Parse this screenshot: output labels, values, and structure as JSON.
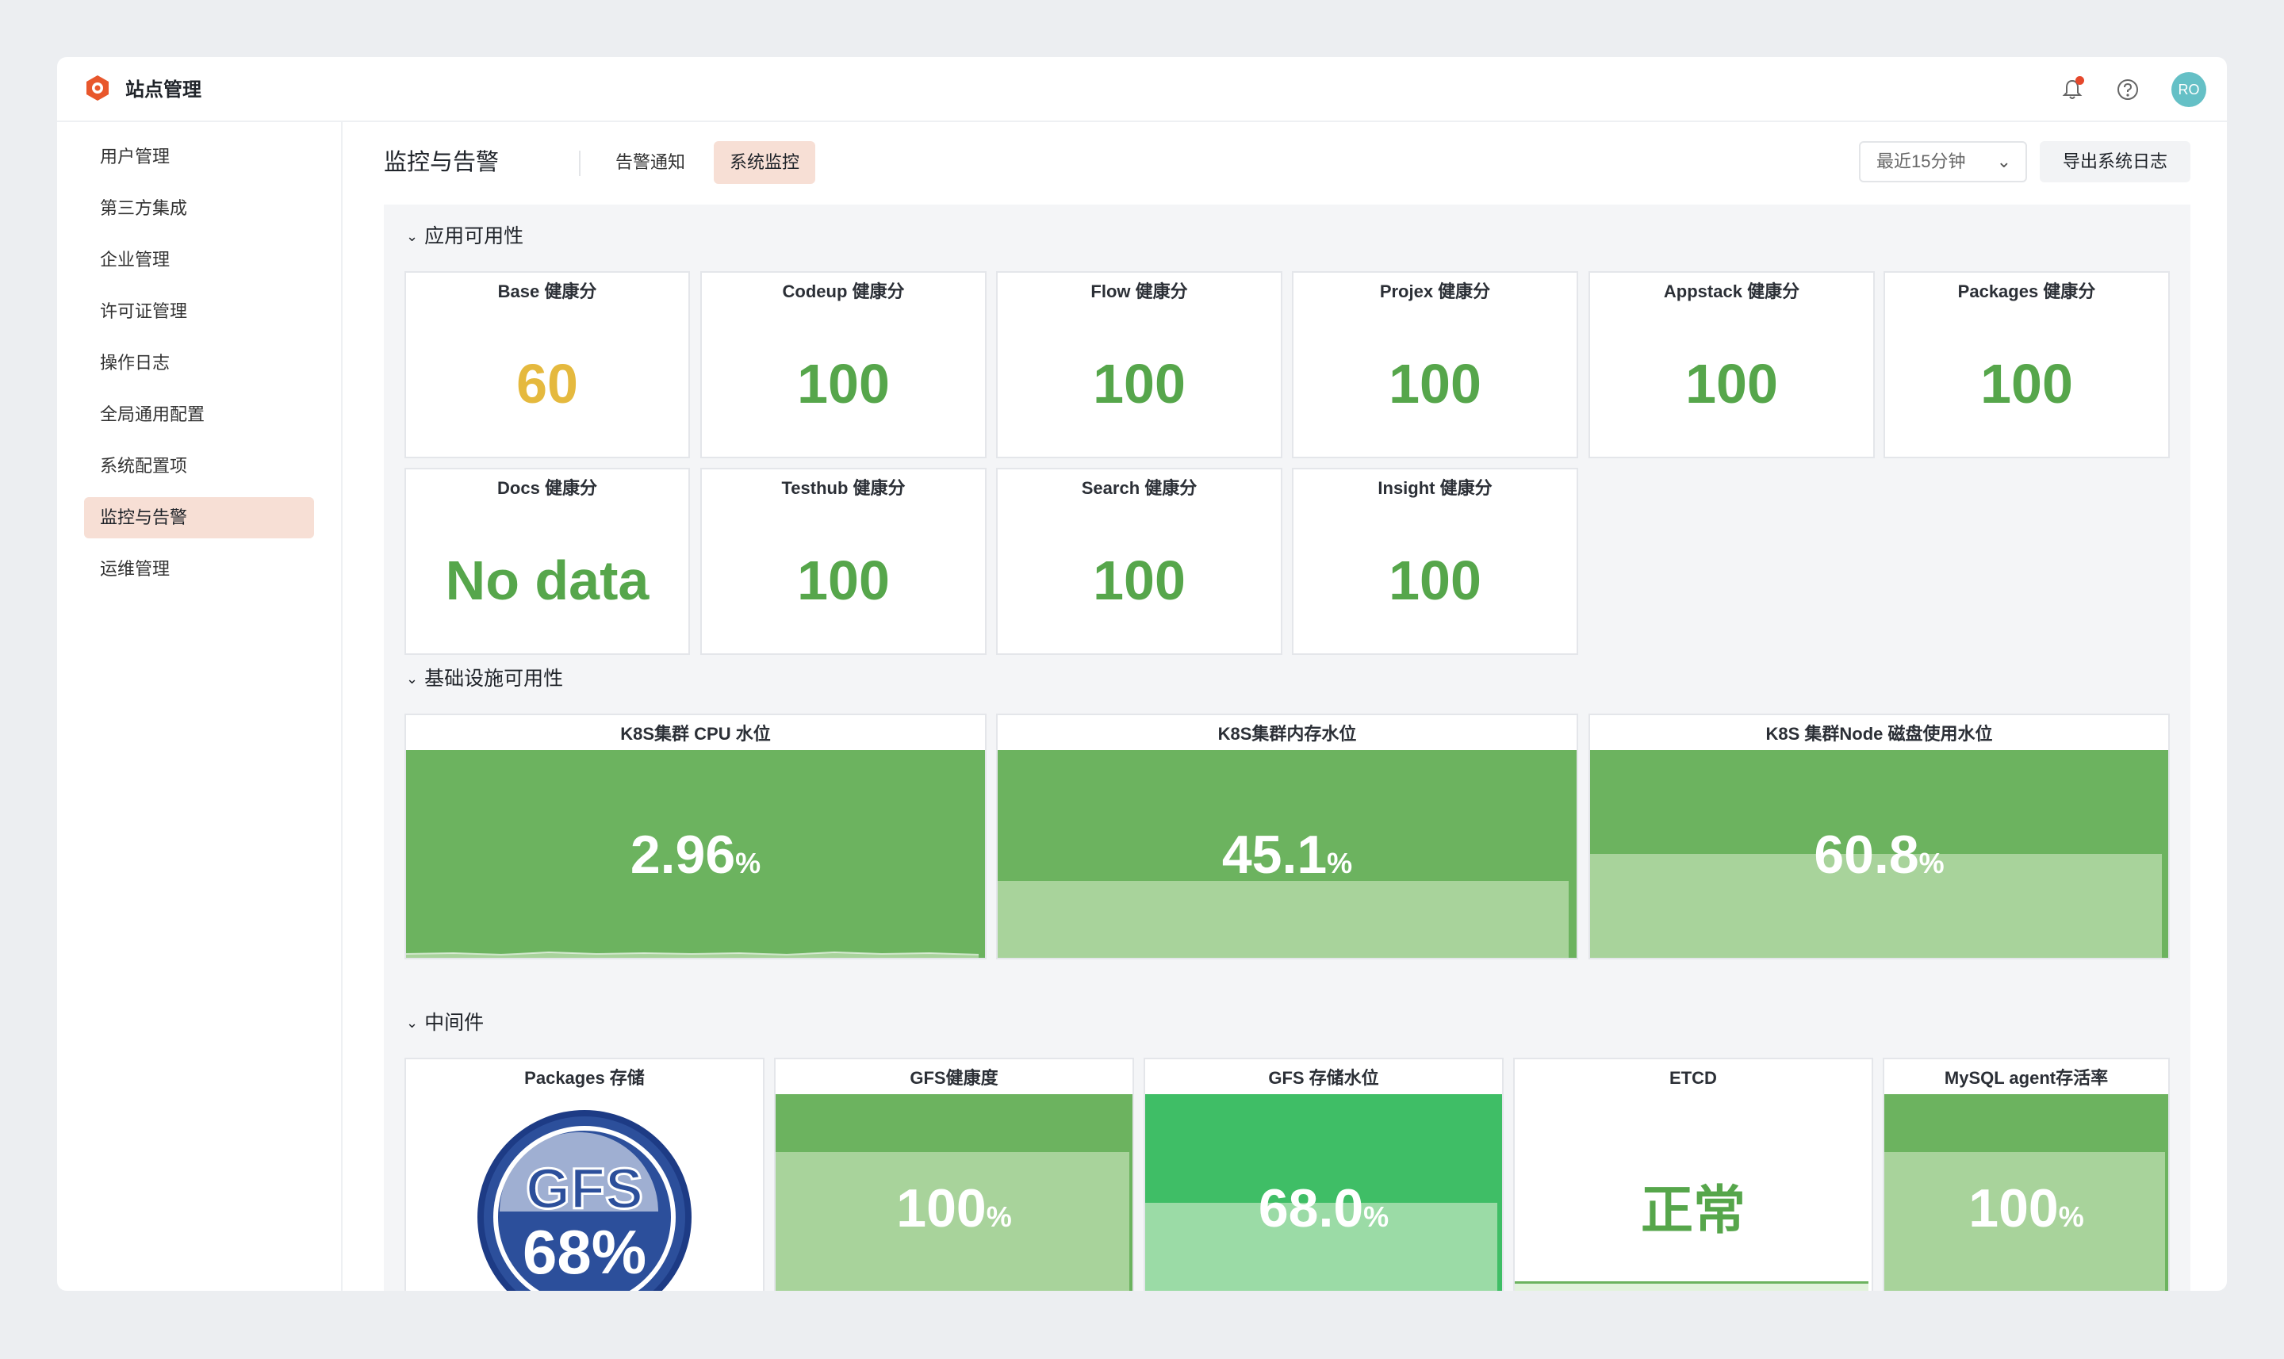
{
  "header": {
    "title": "站点管理",
    "avatar": "RO",
    "icons": [
      "logo-icon",
      "bell-icon",
      "help-icon"
    ],
    "notification_dot_color": "#e5482c"
  },
  "sidebar": {
    "items": [
      {
        "label": "用户管理"
      },
      {
        "label": "第三方集成"
      },
      {
        "label": "企业管理"
      },
      {
        "label": "许可证管理"
      },
      {
        "label": "操作日志"
      },
      {
        "label": "全局通用配置"
      },
      {
        "label": "系统配置项"
      },
      {
        "label": "监控与告警",
        "active": true
      },
      {
        "label": "运维管理"
      }
    ]
  },
  "main": {
    "title": "监控与告警",
    "tabs": [
      {
        "label": "告警通知"
      },
      {
        "label": "系统监控",
        "active": true
      }
    ],
    "time_range": "最近15分钟",
    "export_label": "导出系统日志"
  },
  "sections": {
    "app_availability": {
      "label": "应用可用性",
      "panels": [
        {
          "title": "Base 健康分",
          "value": "60",
          "color": "#e5b93e"
        },
        {
          "title": "Codeup 健康分",
          "value": "100",
          "color": "#56a64b"
        },
        {
          "title": "Flow 健康分",
          "value": "100",
          "color": "#56a64b"
        },
        {
          "title": "Projex 健康分",
          "value": "100",
          "color": "#56a64b"
        },
        {
          "title": "Appstack 健康分",
          "value": "100",
          "color": "#56a64b"
        },
        {
          "title": "Packages 健康分",
          "value": "100",
          "color": "#56a64b"
        },
        {
          "title": "Docs 健康分",
          "value": "No data",
          "color": "#56a64b"
        },
        {
          "title": "Testhub 健康分",
          "value": "100",
          "color": "#56a64b"
        },
        {
          "title": "Search 健康分",
          "value": "100",
          "color": "#56a64b"
        },
        {
          "title": "Insight 健康分",
          "value": "100",
          "color": "#56a64b"
        }
      ]
    },
    "infra": {
      "label": "基础设施可用性",
      "panels": [
        {
          "title": "K8S集群 CPU 水位",
          "value": "2.96",
          "unit": "%",
          "level": 0.0296
        },
        {
          "title": "K8S集群内存水位",
          "value": "45.1",
          "unit": "%",
          "level": 0.451
        },
        {
          "title": "K8S 集群Node 磁盘使用水位",
          "value": "60.8",
          "unit": "%",
          "level": 0.608
        }
      ]
    },
    "middleware": {
      "label": "中间件",
      "packages": {
        "title": "Packages 存储",
        "badge_top": "GFS",
        "badge_bottom": "68%"
      },
      "gfs_health": {
        "title": "GFS健康度",
        "value": "100",
        "unit": "%",
        "level": 1.0
      },
      "gfs_storage": {
        "title": "GFS 存储水位",
        "value": "68.0",
        "unit": "%",
        "level": 0.68
      },
      "etcd": {
        "title": "ETCD",
        "value": "正常"
      },
      "mysql": {
        "title": "MySQL agent存活率",
        "value": "100",
        "unit": "%",
        "level": 1.0
      }
    }
  }
}
